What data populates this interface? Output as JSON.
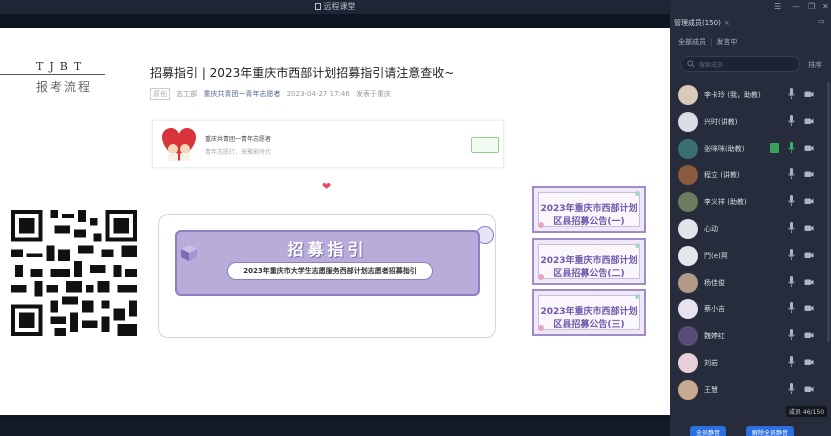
{
  "window": {
    "title": "远程课堂"
  },
  "slide": {
    "brand": "TJBT",
    "brand_sub": "报考流程",
    "article": {
      "title": "招募指引 | 2023年重庆市西部计划招募指引请注意查收~",
      "tag": "原创",
      "author": "志工部",
      "account": "重庆共青团一青年志愿者",
      "date": "2023-04-27 17:46",
      "location": "发表于重庆"
    },
    "account_card": {
      "name": "重庆共青团一青年志愿者",
      "desc": "青年志愿行，来聚影时代"
    },
    "banner": {
      "title": "招募指引",
      "subtitle": "2023年重庆市大学生志愿服务西部计划志愿者招募指引"
    },
    "cards": [
      {
        "line1": "2023年重庆市西部计划",
        "line2": "区县招募公告(一)"
      },
      {
        "line1": "2023年重庆市西部计划",
        "line2": "区县招募公告(二)"
      },
      {
        "line1": "2023年重庆市西部计划",
        "line2": "区县招募公告(三)"
      }
    ]
  },
  "panel": {
    "tab_label": "管理成员(150)",
    "tab_close": "×",
    "filters": [
      "全部成员",
      "发言中"
    ],
    "search_placeholder": "搜索成员",
    "sort_label": "排序",
    "members": [
      {
        "name": "李卡玲 (我，助教)",
        "avatar_color": "#d8c9b8",
        "ppt": false
      },
      {
        "name": "兴时(讲教)",
        "avatar_color": "#d9dde6",
        "ppt": false
      },
      {
        "name": "张咪咪(助教)",
        "avatar_color": "#3a6e73",
        "ppt": true
      },
      {
        "name": "程立 (讲教)",
        "avatar_color": "#8a5a3c",
        "ppt": false
      },
      {
        "name": "李义祥 (助教)",
        "avatar_color": "#6c7a5e",
        "ppt": false
      },
      {
        "name": "心动",
        "avatar_color": "#e1e4ea",
        "ppt": false
      },
      {
        "name": "鬥(e)冥",
        "avatar_color": "#e4e6ec",
        "ppt": false
      },
      {
        "name": "杨佳俊",
        "avatar_color": "#b39a86",
        "ppt": false
      },
      {
        "name": "蔡小吉",
        "avatar_color": "#e6e2ee",
        "ppt": false
      },
      {
        "name": "魏婷红",
        "avatar_color": "#5b4b7a",
        "ppt": false
      },
      {
        "name": "刘岩",
        "avatar_color": "#e8cfd8",
        "ppt": false
      },
      {
        "name": "王慧",
        "avatar_color": "#c7a98f",
        "ppt": false
      }
    ],
    "member_count": "成员 46/150",
    "buttons": [
      "全员静音",
      "解除全员静音"
    ]
  }
}
